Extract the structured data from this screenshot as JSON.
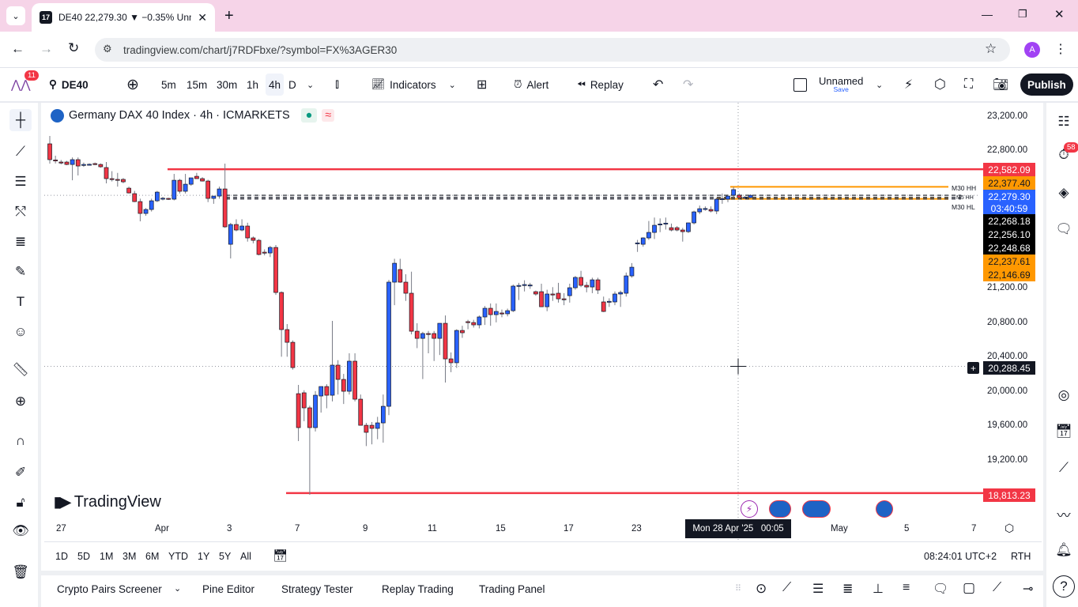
{
  "browser": {
    "tab_title": "DE40 22,279.30 ▼ −0.35% Unn",
    "url": "tradingview.com/chart/j7RDFbxe/?symbol=FX%3AGER30",
    "avatar": "A"
  },
  "toolbar": {
    "notif_count": "11",
    "symbol": "DE40",
    "intervals": [
      "5m",
      "15m",
      "30m",
      "1h",
      "4h",
      "D"
    ],
    "active_interval": "4h",
    "indicators": "Indicators",
    "alert": "Alert",
    "replay": "Replay",
    "layout_name": "Unnamed",
    "save": "Save",
    "publish": "Publish"
  },
  "legend": {
    "title": "Germany DAX 40 Index · 4h · ICMARKETS"
  },
  "right_badge": "58",
  "price_axis": {
    "ticks": [
      "23,200.00",
      "22,800.00",
      "21,200.00",
      "20,800.00",
      "20,400.00",
      "20,000.00",
      "19,600.00",
      "19,200.00"
    ],
    "tags": [
      {
        "v": "22,582.09",
        "bg": "#f23645",
        "fg": "#ffffff"
      },
      {
        "v": "22,377.40",
        "bg": "#ff9800",
        "fg": "#131722"
      },
      {
        "v": "22,279.30",
        "bg": "#2962ff",
        "fg": "#ffffff"
      },
      {
        "v": "03:40:59",
        "bg": "#2962ff",
        "fg": "#ffffff"
      },
      {
        "v": "22,268.18",
        "bg": "#000000",
        "fg": "#ffffff"
      },
      {
        "v": "22,256.10",
        "bg": "#000000",
        "fg": "#ffffff"
      },
      {
        "v": "22,248.68",
        "bg": "#000000",
        "fg": "#ffffff"
      },
      {
        "v": "22,237.61",
        "bg": "#ff9800",
        "fg": "#131722"
      },
      {
        "v": "22,146.69",
        "bg": "#ff9800",
        "fg": "#131722"
      }
    ],
    "crosshair_price": "20,288.45",
    "low_tag": "18,813.23"
  },
  "line_labels": {
    "hh": "M30 HH",
    "hl": "M30 HL",
    "m5": "M5 HH"
  },
  "time_axis": {
    "labels": [
      "27",
      "Apr",
      "3",
      "7",
      "9",
      "11",
      "15",
      "17",
      "23",
      "May",
      "5",
      "7"
    ],
    "crosshair_time": "Mon 28 Apr '25   00:05"
  },
  "watermark": "TradingView",
  "range_bar": {
    "ranges": [
      "1D",
      "5D",
      "1M",
      "3M",
      "6M",
      "YTD",
      "1Y",
      "5Y",
      "All"
    ],
    "clock": "08:24:01 UTC+2",
    "session": "RTH"
  },
  "bottom_tabs": [
    "Crypto Pairs Screener",
    "Pine Editor",
    "Strategy Tester",
    "Replay Trading",
    "Trading Panel"
  ],
  "colors": {
    "up": "#2962ff",
    "down": "#f23645",
    "level": "#f23645",
    "orange": "#ff9800"
  },
  "chart_data": {
    "type": "candlestick",
    "symbol": "DE40",
    "interval": "4h",
    "ylim": [
      18700,
      23350
    ],
    "levels": [
      {
        "price": 22582.09,
        "color": "red"
      },
      {
        "price": 18813.23,
        "color": "red"
      },
      {
        "price": 22377.4,
        "color": "orange",
        "label": "M30 HH"
      },
      {
        "price": 22237.61,
        "color": "orange",
        "label": "M30 HL"
      },
      {
        "price": 22268.18,
        "style": "dashed"
      },
      {
        "price": 22256.1,
        "style": "dashed"
      },
      {
        "price": 22248.68,
        "style": "dashed"
      }
    ],
    "crosshair": {
      "price": 20288.45,
      "time": "Mon 28 Apr '25 00:05"
    },
    "ohlc": [
      [
        22878,
        22970,
        22648,
        22694
      ],
      [
        22690,
        22740,
        22650,
        22684
      ],
      [
        22666,
        22690,
        22640,
        22657
      ],
      [
        22666,
        22680,
        22630,
        22638
      ],
      [
        22638,
        22720,
        22454,
        22694
      ],
      [
        22694,
        22720,
        22510,
        22620
      ],
      [
        22629,
        22660,
        22610,
        22638
      ],
      [
        22638,
        22650,
        22625,
        22640
      ],
      [
        22648,
        22660,
        22630,
        22645
      ],
      [
        22638,
        22650,
        22600,
        22611
      ],
      [
        22602,
        22666,
        22418,
        22473
      ],
      [
        22473,
        22560,
        22440,
        22464
      ],
      [
        22464,
        22540,
        22380,
        22460
      ],
      [
        22464,
        22480,
        22420,
        22436
      ],
      [
        22362,
        22380,
        22300,
        22307
      ],
      [
        22298,
        22330,
        22200,
        22206
      ],
      [
        22206,
        22240,
        21976,
        22068
      ],
      [
        22068,
        22130,
        22040,
        22114
      ],
      [
        22114,
        22240,
        22090,
        22215
      ],
      [
        22215,
        22330,
        22200,
        22316
      ],
      [
        22243,
        22260,
        22220,
        22245
      ],
      [
        22243,
        22250,
        22225,
        22234
      ],
      [
        22234,
        22528,
        22220,
        22454
      ],
      [
        22454,
        22470,
        22300,
        22326
      ],
      [
        22326,
        22528,
        22300,
        22408
      ],
      [
        22408,
        22480,
        22390,
        22482
      ],
      [
        22500,
        22540,
        22480,
        22473
      ],
      [
        22473,
        22490,
        22440,
        22445
      ],
      [
        22445,
        22460,
        22200,
        22243
      ],
      [
        22243,
        22270,
        22180,
        22270
      ],
      [
        22270,
        22380,
        22240,
        22353
      ],
      [
        22353,
        22648,
        21900,
        21912
      ],
      [
        21709,
        21958,
        21544,
        21939
      ],
      [
        21939,
        22000,
        21860,
        21875
      ],
      [
        21875,
        22000,
        21860,
        21921
      ],
      [
        21921,
        21960,
        21740,
        21783
      ],
      [
        21783,
        21800,
        21720,
        21755
      ],
      [
        21755,
        21770,
        21580,
        21590
      ],
      [
        21617,
        21650,
        21580,
        21610
      ],
      [
        21608,
        21690,
        21560,
        21672
      ],
      [
        21672,
        21700,
        21120,
        21148
      ],
      [
        21148,
        21160,
        20400,
        20716
      ],
      [
        20716,
        20780,
        20400,
        20568
      ],
      [
        20568,
        20590,
        20250,
        20274
      ],
      [
        19970,
        20072,
        19418,
        19575
      ],
      [
        19980,
        20010,
        19650,
        19805
      ],
      [
        19805,
        19830,
        18793,
        19575
      ],
      [
        19575,
        20000,
        19530,
        19952
      ],
      [
        19943,
        20030,
        19750,
        20053
      ],
      [
        20053,
        20080,
        19800,
        19952
      ],
      [
        19952,
        20817,
        19880,
        20302
      ],
      [
        20302,
        20360,
        19960,
        20136
      ],
      [
        20136,
        20200,
        19850,
        19998
      ],
      [
        19998,
        20440,
        19960,
        20348
      ],
      [
        20348,
        20440,
        19880,
        19906
      ],
      [
        19906,
        19960,
        19600,
        19602
      ],
      [
        19602,
        19630,
        19360,
        19520
      ],
      [
        19602,
        19640,
        19380,
        19566
      ],
      [
        19566,
        19700,
        19440,
        19630
      ],
      [
        19630,
        19960,
        19400,
        19823
      ],
      [
        19823,
        21295,
        19720,
        21268
      ],
      [
        21268,
        21540,
        21000,
        21488
      ],
      [
        21415,
        21540,
        21260,
        21268
      ],
      [
        21268,
        21360,
        21050,
        21139
      ],
      [
        21139,
        21390,
        20660,
        20697
      ],
      [
        20697,
        20790,
        20500,
        20614
      ],
      [
        20614,
        20690,
        20140,
        20670
      ],
      [
        20670,
        20700,
        20440,
        20660
      ],
      [
        20670,
        20700,
        20350,
        20614
      ],
      [
        20614,
        20790,
        20420,
        20789
      ],
      [
        20789,
        20881,
        20100,
        20375
      ],
      [
        20375,
        20450,
        20220,
        20330
      ],
      [
        20330,
        20720,
        20270,
        20706
      ],
      [
        20706,
        20760,
        20620,
        20679
      ],
      [
        20808,
        20830,
        20720,
        20800
      ],
      [
        20798,
        20830,
        20740,
        20771
      ],
      [
        20771,
        20880,
        20730,
        20863
      ],
      [
        20863,
        20990,
        20770,
        20964
      ],
      [
        20964,
        21020,
        20760,
        20890
      ],
      [
        20890,
        21020,
        20800,
        20927
      ],
      [
        20909,
        20950,
        20860,
        20905
      ],
      [
        20900,
        20960,
        20870,
        20936
      ],
      [
        20936,
        21240,
        20920,
        21222
      ],
      [
        21222,
        21260,
        21060,
        21230
      ],
      [
        21231,
        21290,
        21160,
        21240
      ],
      [
        21231,
        21260,
        21190,
        21235
      ],
      [
        21157,
        21170,
        21110,
        21130
      ],
      [
        21157,
        21250,
        20980,
        20982
      ],
      [
        20982,
        21180,
        20930,
        21130
      ],
      [
        21130,
        21210,
        21050,
        21125
      ],
      [
        21139,
        21260,
        21030,
        21074
      ],
      [
        21074,
        21140,
        21000,
        21070
      ],
      [
        21111,
        21250,
        21030,
        21203
      ],
      [
        21203,
        21340,
        21180,
        21323
      ],
      [
        21323,
        21400,
        21210,
        21231
      ],
      [
        21231,
        21270,
        21150,
        21212
      ],
      [
        21212,
        21320,
        21140,
        21295
      ],
      [
        21295,
        21320,
        21130,
        21176
      ],
      [
        21038,
        21100,
        20920,
        20927
      ],
      [
        21038,
        21080,
        20980,
        21045
      ],
      [
        21038,
        21160,
        21000,
        21130
      ],
      [
        21130,
        21170,
        20980,
        21148
      ],
      [
        21139,
        21380,
        21100,
        21341
      ],
      [
        21341,
        21490,
        21320,
        21442
      ],
      [
        21718,
        21760,
        21620,
        21725
      ],
      [
        21709,
        21790,
        21680,
        21783
      ],
      [
        21783,
        21980,
        21760,
        21847
      ],
      [
        21847,
        22020,
        21770,
        21930
      ],
      [
        21939,
        22010,
        21850,
        21945
      ],
      [
        21948,
        22020,
        21880,
        21955
      ],
      [
        21902,
        21950,
        21860,
        21875
      ],
      [
        21902,
        21920,
        21860,
        21875
      ],
      [
        21875,
        21900,
        21740,
        21856
      ],
      [
        21856,
        21960,
        21840,
        21958
      ],
      [
        21958,
        22100,
        21940,
        22086
      ],
      [
        22086,
        22160,
        22060,
        22123
      ],
      [
        22123,
        22150,
        22100,
        22125
      ],
      [
        22114,
        22150,
        22080,
        22096
      ],
      [
        22096,
        22250,
        22060,
        22234
      ],
      [
        22234,
        22300,
        22180,
        22240
      ],
      [
        22234,
        22290,
        22200,
        22270
      ],
      [
        22280,
        22377,
        22260,
        22345
      ],
      [
        22280,
        22300,
        22230,
        22252
      ],
      [
        22252,
        22270,
        22240,
        22255
      ],
      [
        22252,
        22290,
        22245,
        22279
      ]
    ]
  }
}
